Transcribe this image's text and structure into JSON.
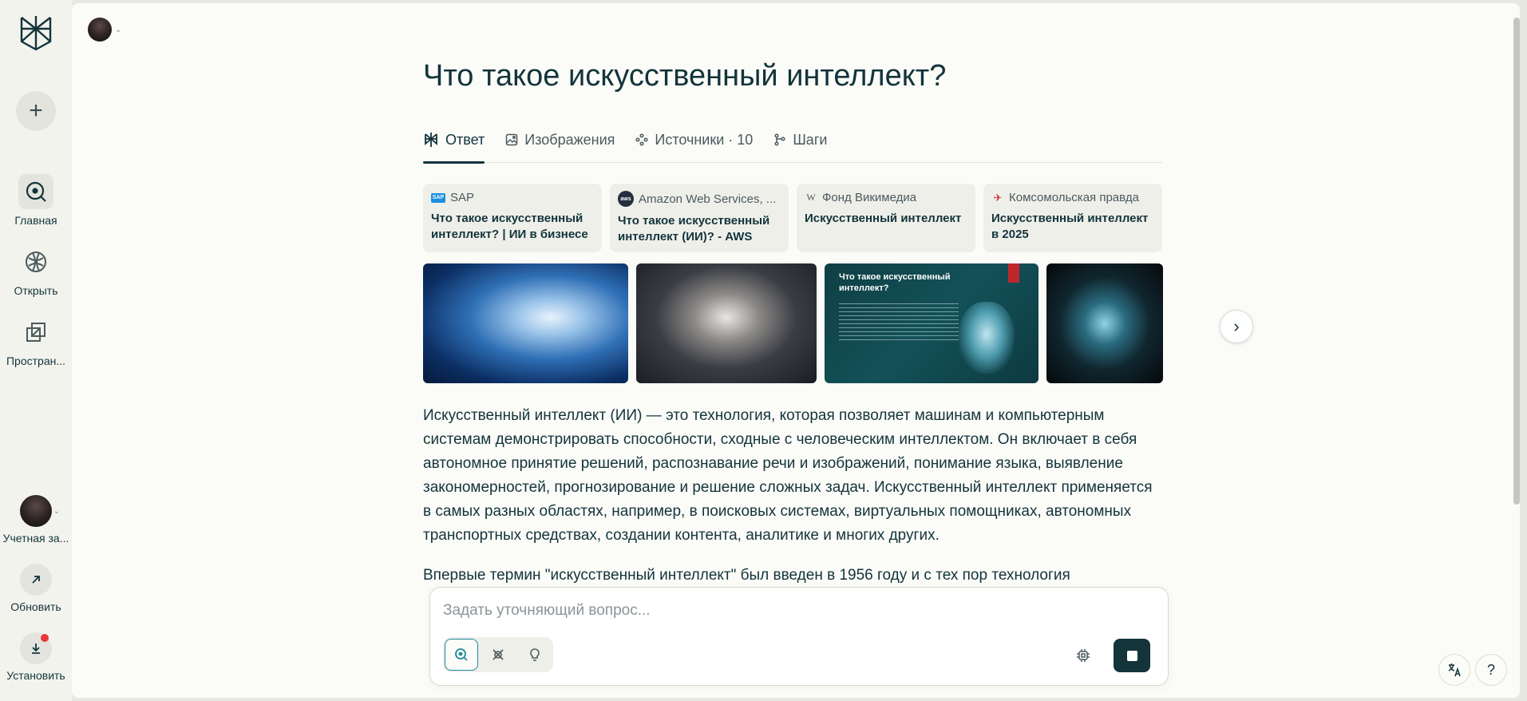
{
  "sidebar": {
    "new_label": "+",
    "items": [
      {
        "label": "Главная"
      },
      {
        "label": "Открыть"
      },
      {
        "label": "Простран..."
      }
    ],
    "account_label": "Учетная за...",
    "update_label": "Обновить",
    "install_label": "Установить"
  },
  "query": {
    "title": "Что такое искусственный интеллект?"
  },
  "tabs": [
    {
      "label": "Ответ"
    },
    {
      "label": "Изображения"
    },
    {
      "label": "Источники · 10"
    },
    {
      "label": "Шаги"
    }
  ],
  "sources": [
    {
      "site": "SAP",
      "title": "Что такое искусственный интеллект? | ИИ в бизнесе"
    },
    {
      "site": "Amazon Web Services, ...",
      "title": "Что такое искусственный интеллект (ИИ)? - AWS"
    },
    {
      "site": "Фонд Викимедиа",
      "title": "Искусственный интеллект"
    },
    {
      "site": "Комсомольская правда",
      "title": "Искусственный интеллект в 2025"
    }
  ],
  "images": {
    "slide_title": "Что такое искусственный интеллект?"
  },
  "answer": {
    "p1": "Искусственный интеллект (ИИ) — это технология, которая позволяет машинам и компьютерным системам демонстрировать способности, сходные с человеческим интеллектом. Он включает в себя автономное принятие решений, распознавание речи и изображений, понимание языка, выявление закономерностей, прогнозирование и решение сложных задач. Искусственный интеллект применяется в самых разных областях, например, в поисковых системах, виртуальных помощниках, автономных транспортных средствах, создании контента, аналитике и многих других.",
    "p2": "Впервые термин \"искусственный интеллект\" был введен в 1956 году и с тех пор технология"
  },
  "followup": {
    "placeholder": "Задать уточняющий вопрос..."
  },
  "colors": {
    "accent": "#1f8a9b",
    "text": "#13343b",
    "background": "#fbfbf8",
    "badge": "#e53935"
  }
}
